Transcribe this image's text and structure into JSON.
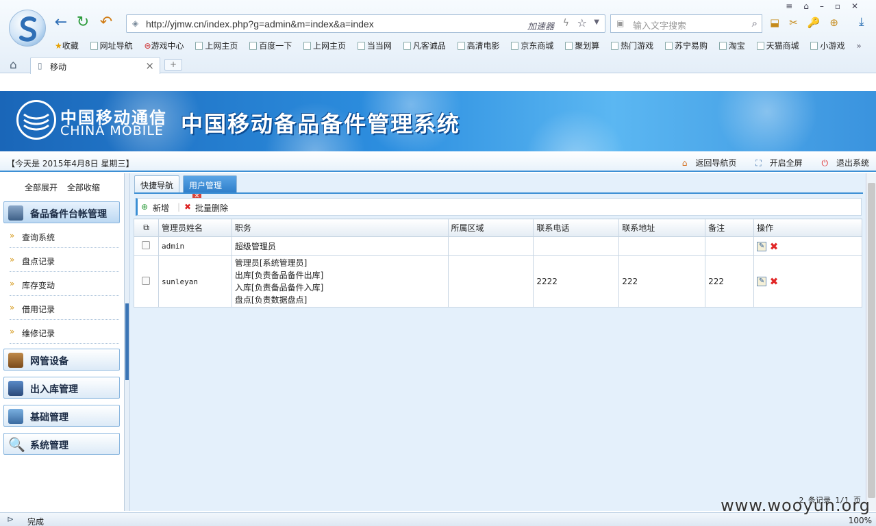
{
  "browser": {
    "url": "http://yjmw.cn/index.php?g=admin&m=index&a=index",
    "accelerator": "加速器",
    "search_placeholder": "输入文字搜索",
    "bookmarks": [
      "收藏",
      "网址导航",
      "游戏中心",
      "上网主页",
      "百度一下",
      "上网主页",
      "当当网",
      "凡客诚品",
      "高清电影",
      "京东商城",
      "聚划算",
      "热门游戏",
      "苏宁易购",
      "淘宝",
      "天猫商城",
      "小游戏"
    ],
    "tab_title": "移动",
    "new_tab": "+",
    "status": "完成",
    "zoom": "100%"
  },
  "banner": {
    "brand_cn": "中国移动通信",
    "brand_en": "CHINA MOBILE",
    "system_title": "中国移动备品备件管理系统"
  },
  "infobar": {
    "date": "【今天是 2015年4月8日 星期三】",
    "back_nav": "返回导航页",
    "fullscreen": "开启全屏",
    "logout": "退出系统"
  },
  "sidebar": {
    "expand_all": "全部展开",
    "collapse_all": "全部收缩",
    "groups": [
      {
        "label": "备品备件台帐管理",
        "items": [
          "查询系统",
          "盘点记录",
          "库存变动",
          "借用记录",
          "维修记录"
        ]
      },
      {
        "label": "网管设备"
      },
      {
        "label": "出入库管理"
      },
      {
        "label": "基础管理"
      },
      {
        "label": "系统管理"
      }
    ]
  },
  "tabs": [
    "快捷导航",
    "用户管理"
  ],
  "toolbar": {
    "add": "新增",
    "batch_delete": "批量删除"
  },
  "table": {
    "headers": [
      "管理员姓名",
      "职务",
      "所属区域",
      "联系电话",
      "联系地址",
      "备注",
      "操作"
    ],
    "rows": [
      {
        "name": "admin",
        "role": [
          "超级管理员"
        ],
        "area": "",
        "phone": "",
        "address": "",
        "note": ""
      },
      {
        "name": "sunleyan",
        "role": [
          "管理员[系统管理员]",
          "出库[负责备品备件出库]",
          "入库[负责备品备件入库]",
          "盘点[负责数据盘点]"
        ],
        "area": "",
        "phone": "2222",
        "address": "222",
        "note": "222"
      }
    ]
  },
  "pager": "2 条记录 1/1 页",
  "watermark": "www.wooyun.org"
}
